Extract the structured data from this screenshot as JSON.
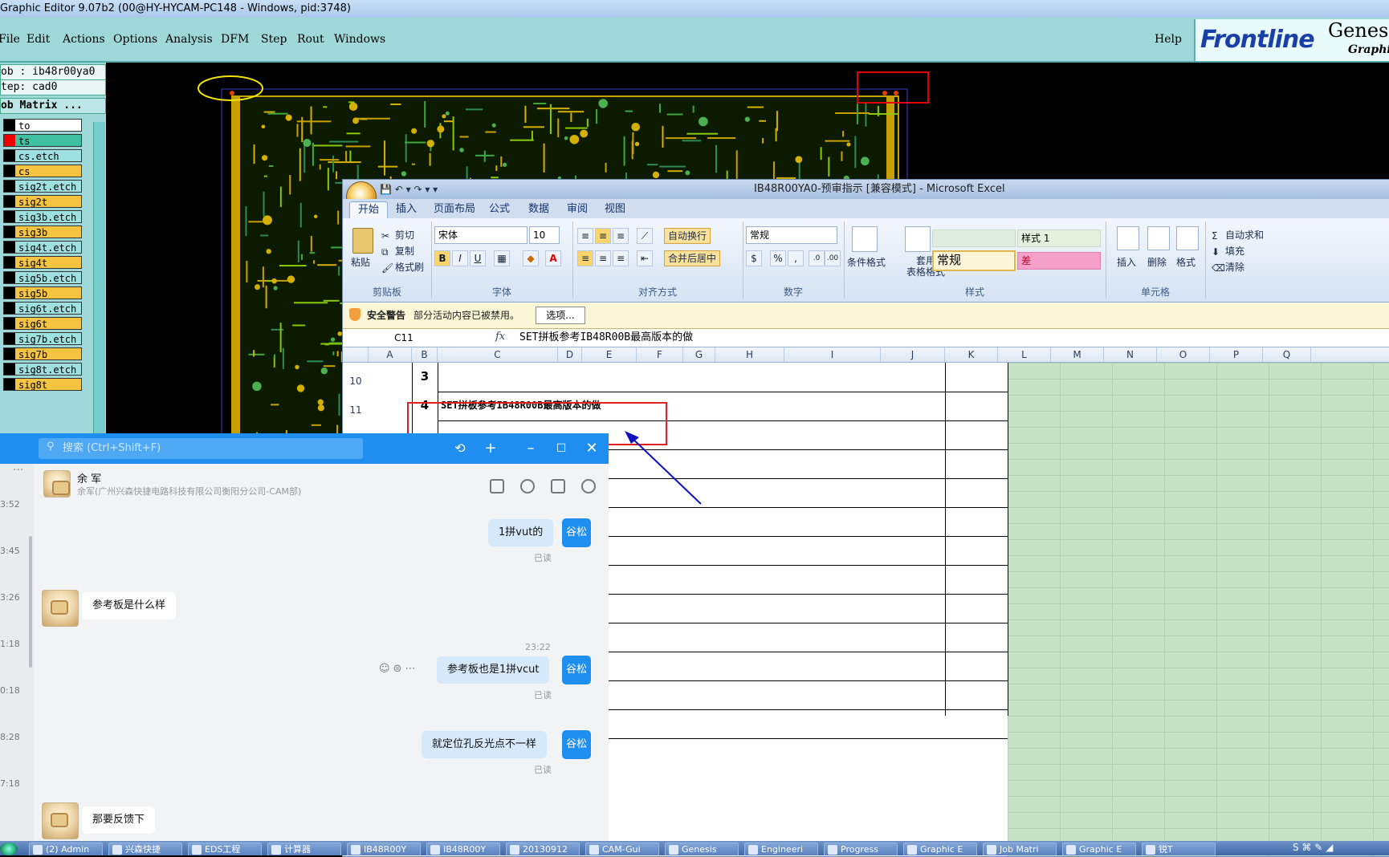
{
  "genesis": {
    "title": "Graphic Editor 9.07b2 (00@HY-HYCAM-PC148 - Windows, pid:3748)",
    "menu": [
      "File",
      "Edit",
      "Actions",
      "Options",
      "Analysis",
      "DFM",
      "Step",
      "Rout",
      "Windows"
    ],
    "help": "Help",
    "logo": {
      "brand": "Frontline",
      "product": "Genesis",
      "sub": "Graphic"
    },
    "job": "ob : ib48r00ya0",
    "step": "tep: cad0",
    "job_matrix": "ob Matrix ...",
    "layers": [
      {
        "name": "to",
        "color": "#ffffff"
      },
      {
        "name": "ts",
        "color": "#40c0a0"
      },
      {
        "name": "cs.etch",
        "color": "#9fe0e0"
      },
      {
        "name": "cs",
        "color": "#f5c542"
      },
      {
        "name": "sig2t.etch",
        "color": "#9fe0e0"
      },
      {
        "name": "sig2t",
        "color": "#f5c542"
      },
      {
        "name": "sig3b.etch",
        "color": "#9fe0e0"
      },
      {
        "name": "sig3b",
        "color": "#f5c542"
      },
      {
        "name": "sig4t.etch",
        "color": "#9fe0e0"
      },
      {
        "name": "sig4t",
        "color": "#f5c542"
      },
      {
        "name": "sig5b.etch",
        "color": "#9fe0e0"
      },
      {
        "name": "sig5b",
        "color": "#f5c542"
      },
      {
        "name": "sig6t.etch",
        "color": "#9fe0e0"
      },
      {
        "name": "sig6t",
        "color": "#f5c542"
      },
      {
        "name": "sig7b.etch",
        "color": "#9fe0e0"
      },
      {
        "name": "sig7b",
        "color": "#f5c542"
      },
      {
        "name": "sig8t.etch",
        "color": "#9fe0e0"
      },
      {
        "name": "sig8t",
        "color": "#f5c542"
      }
    ]
  },
  "excel": {
    "title": "IB48R00YA0-预审指示 [兼容模式] - Microsoft Excel",
    "tabs": [
      "开始",
      "插入",
      "页面布局",
      "公式",
      "数据",
      "审阅",
      "视图"
    ],
    "clipboard": {
      "paste": "粘贴",
      "cut": "剪切",
      "copy": "复制",
      "painter": "格式刷",
      "group": "剪贴板"
    },
    "font": {
      "name": "宋体",
      "size": "10",
      "group": "字体"
    },
    "align": {
      "wrap": "自动换行",
      "merge": "合并后居中",
      "group": "对齐方式"
    },
    "number": {
      "format": "常规",
      "group": "数字",
      "percent": "%",
      "comma": ","
    },
    "styles": {
      "cond": "条件格式",
      "table": "套用\n表格格式",
      "normal": "常规",
      "style1": "样式 1",
      "bad": "差",
      "group": "样式"
    },
    "cells": {
      "insert": "插入",
      "delete": "删除",
      "format": "格式",
      "group": "单元格"
    },
    "editing": {
      "sum": "自动求和",
      "fill": "填充",
      "clear": "清除"
    },
    "security": {
      "label": "安全警告",
      "message": "部分活动内容已被禁用。",
      "button": "选项..."
    },
    "namebox": "C11",
    "fx": "fx",
    "formula": "SET拼板参考IB48R00B最高版本的做",
    "columns": [
      "A",
      "B",
      "C",
      "D",
      "E",
      "F",
      "G",
      "H",
      "I",
      "J",
      "K",
      "L",
      "M",
      "N",
      "O",
      "P",
      "Q"
    ],
    "rows": [
      {
        "num": "10",
        "b": "3",
        "c": ""
      },
      {
        "num": "11",
        "b": "4",
        "c": "SET拼板参考IB48R00B最高版本的做"
      }
    ]
  },
  "chat": {
    "search_placeholder": "搜索 (Ctrl+Shift+F)",
    "contact_name": "余 军",
    "contact_org": "余军(广州兴森快捷电路科技有限公司衡阳分公司-CAM部)",
    "side_times": [
      "3:52",
      "3:45",
      "3:26",
      "1:18",
      "0:18",
      "8:28",
      "7:18"
    ],
    "more": "···",
    "time_mid": "23:22",
    "read": "已读",
    "avatar_me": "谷松",
    "messages": [
      {
        "side": "right",
        "text": "1拼vut的"
      },
      {
        "side": "left",
        "text": "参考板是什么样"
      },
      {
        "side": "right",
        "text": "参考板也是1拼vcut"
      },
      {
        "side": "right",
        "text": "就定位孔反光点不一样"
      },
      {
        "side": "left",
        "text": "那要反馈下"
      }
    ]
  },
  "taskbar": {
    "items": [
      "(2) Admin",
      "兴森快捷",
      "EDS工程",
      "计算器",
      "IB48R00Y",
      "IB48R00Y",
      "20130912",
      "CAM-Gui",
      "Genesis",
      "Engineeri",
      "Progress",
      "Graphic E",
      "Job Matri",
      "Graphic E",
      "锐T"
    ]
  }
}
